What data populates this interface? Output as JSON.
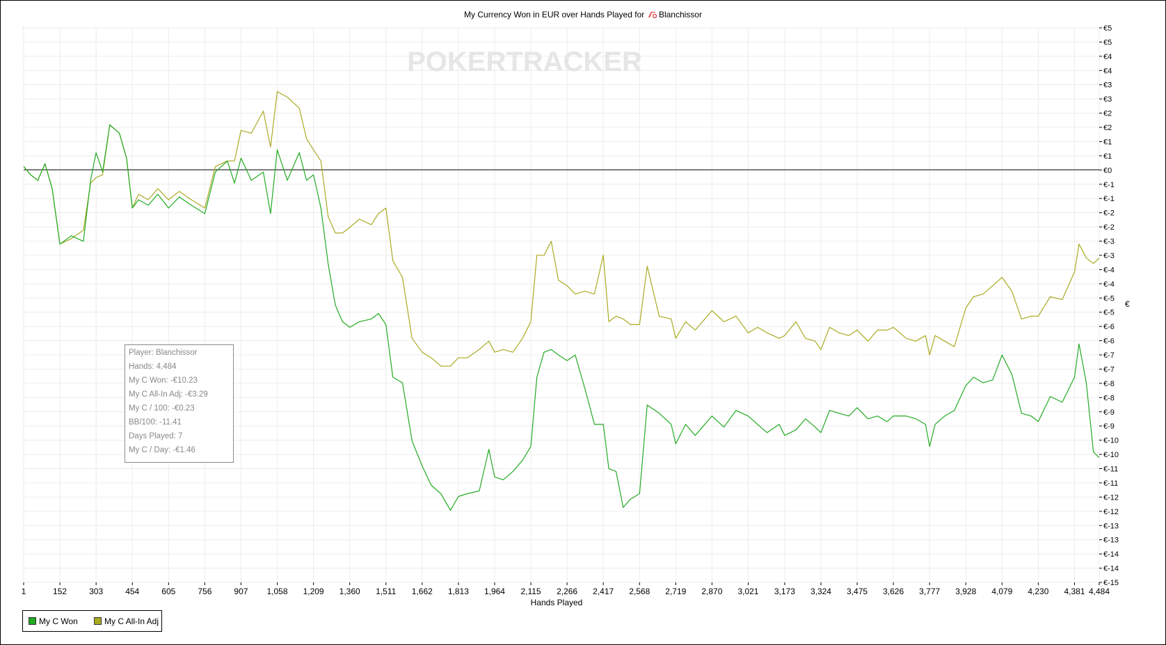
{
  "chart_data": {
    "type": "line",
    "title": "My Currency Won in EUR over Hands Played for  Blanchissor",
    "title_text": "My Currency Won in EUR over Hands Played for",
    "player_name": "Blanchissor",
    "xlabel": "Hands Played",
    "ylabel": "€",
    "xlim": [
      1,
      4484
    ],
    "ylim": [
      -15,
      5
    ],
    "grid": true,
    "legend_position": "bottom-left",
    "x_ticks": [
      "1",
      "152",
      "303",
      "454",
      "605",
      "756",
      "907",
      "1,058",
      "1,209",
      "1,360",
      "1,511",
      "1,662",
      "1,813",
      "1,964",
      "2,115",
      "2,266",
      "2,417",
      "2,568",
      "2,719",
      "2,870",
      "3,021",
      "3,173",
      "3,324",
      "3,475",
      "3,626",
      "3,777",
      "3,928",
      "4,079",
      "4,230",
      "4,381",
      "4,484"
    ],
    "y_ticks": [
      "€5",
      "€5",
      "€4",
      "€4",
      "€3",
      "€3",
      "€2",
      "€2",
      "€1",
      "€1",
      "€0",
      "€-1",
      "€-1",
      "€-2",
      "€-2",
      "€-3",
      "€-3",
      "€-4",
      "€-4",
      "€-5",
      "€-5",
      "€-6",
      "€-6",
      "€-7",
      "€-7",
      "€-8",
      "€-8",
      "€-9",
      "€-9",
      "€-10",
      "€-10",
      "€-11",
      "€-11",
      "€-12",
      "€-12",
      "€-13",
      "€-13",
      "€-14",
      "€-14",
      "€-15"
    ],
    "series": [
      {
        "name": "My C Won",
        "color": "#22aa22",
        "x": [
          1,
          30,
          60,
          90,
          120,
          152,
          200,
          250,
          280,
          303,
          330,
          360,
          400,
          430,
          454,
          480,
          520,
          560,
          605,
          650,
          700,
          756,
          800,
          850,
          880,
          907,
          950,
          1000,
          1030,
          1058,
          1100,
          1150,
          1180,
          1209,
          1240,
          1270,
          1300,
          1330,
          1360,
          1400,
          1450,
          1480,
          1511,
          1540,
          1580,
          1620,
          1662,
          1700,
          1740,
          1780,
          1813,
          1850,
          1900,
          1940,
          1964,
          2000,
          2040,
          2080,
          2115,
          2140,
          2170,
          2200,
          2230,
          2266,
          2300,
          2340,
          2380,
          2417,
          2440,
          2470,
          2500,
          2530,
          2568,
          2600,
          2650,
          2700,
          2719,
          2760,
          2800,
          2870,
          2920,
          2970,
          3021,
          3060,
          3100,
          3150,
          3173,
          3220,
          3260,
          3300,
          3324,
          3360,
          3400,
          3440,
          3475,
          3520,
          3560,
          3600,
          3626,
          3680,
          3720,
          3760,
          3777,
          3800,
          3840,
          3880,
          3928,
          3960,
          4000,
          4040,
          4079,
          4120,
          4160,
          4200,
          4230,
          4280,
          4330,
          4381,
          4400,
          4430,
          4460,
          4484
        ],
        "values": [
          0,
          -0.3,
          -0.5,
          0.1,
          -0.8,
          -2.8,
          -2.5,
          -2.7,
          -0.5,
          0.5,
          -0.2,
          1.5,
          1.2,
          0.3,
          -1.5,
          -1.2,
          -1.4,
          -1.0,
          -1.5,
          -1.1,
          -1.4,
          -1.7,
          -0.2,
          0.2,
          -0.6,
          0.3,
          -0.5,
          -0.2,
          -1.7,
          0.6,
          -0.5,
          0.5,
          -0.5,
          -0.3,
          -1.5,
          -3.5,
          -5.0,
          -5.6,
          -5.8,
          -5.6,
          -5.5,
          -5.3,
          -5.7,
          -7.6,
          -7.8,
          -9.9,
          -10.8,
          -11.5,
          -11.8,
          -12.4,
          -11.9,
          -11.8,
          -11.7,
          -10.2,
          -11.2,
          -11.3,
          -11.0,
          -10.6,
          -10.1,
          -7.6,
          -6.7,
          -6.6,
          -6.8,
          -7.0,
          -6.8,
          -8.0,
          -9.3,
          -9.3,
          -10.9,
          -11.0,
          -12.3,
          -12.0,
          -11.8,
          -8.6,
          -8.9,
          -9.3,
          -10.0,
          -9.3,
          -9.7,
          -9.0,
          -9.4,
          -8.8,
          -9.0,
          -9.3,
          -9.6,
          -9.3,
          -9.7,
          -9.5,
          -9.1,
          -9.4,
          -9.6,
          -8.8,
          -8.9,
          -9.0,
          -8.7,
          -9.1,
          -9.0,
          -9.2,
          -9.0,
          -9.0,
          -9.1,
          -9.3,
          -10.1,
          -9.3,
          -9.0,
          -8.8,
          -7.9,
          -7.6,
          -7.8,
          -7.7,
          -6.8,
          -7.5,
          -8.9,
          -9.0,
          -9.2,
          -8.3,
          -8.5,
          -7.6,
          -6.4,
          -7.8,
          -10.3,
          -10.5
        ]
      },
      {
        "name": "My C All-In Adj",
        "color": "#aaaa22",
        "x": [
          1,
          30,
          60,
          90,
          120,
          152,
          200,
          250,
          280,
          303,
          330,
          360,
          400,
          430,
          454,
          480,
          520,
          560,
          605,
          650,
          700,
          756,
          800,
          850,
          880,
          907,
          950,
          1000,
          1030,
          1058,
          1100,
          1150,
          1180,
          1209,
          1240,
          1270,
          1300,
          1330,
          1360,
          1400,
          1450,
          1480,
          1511,
          1540,
          1580,
          1620,
          1662,
          1700,
          1740,
          1780,
          1813,
          1850,
          1900,
          1940,
          1964,
          2000,
          2040,
          2080,
          2115,
          2140,
          2170,
          2200,
          2230,
          2266,
          2300,
          2340,
          2380,
          2417,
          2440,
          2470,
          2500,
          2530,
          2568,
          2600,
          2650,
          2700,
          2719,
          2760,
          2800,
          2870,
          2920,
          2970,
          3021,
          3060,
          3100,
          3150,
          3173,
          3220,
          3260,
          3300,
          3324,
          3360,
          3400,
          3440,
          3475,
          3520,
          3560,
          3600,
          3626,
          3680,
          3720,
          3760,
          3777,
          3800,
          3840,
          3880,
          3928,
          3960,
          4000,
          4040,
          4079,
          4120,
          4160,
          4200,
          4230,
          4280,
          4330,
          4381,
          4400,
          4430,
          4460,
          4484
        ],
        "values": [
          0,
          -0.3,
          -0.5,
          0.1,
          -0.8,
          -2.8,
          -2.6,
          -2.3,
          -0.6,
          -0.4,
          -0.3,
          1.5,
          1.2,
          0.3,
          -1.5,
          -1.0,
          -1.2,
          -0.8,
          -1.2,
          -0.9,
          -1.2,
          -1.5,
          0.0,
          0.2,
          0.2,
          1.3,
          1.2,
          2.0,
          0.7,
          2.7,
          2.5,
          2.1,
          1.0,
          0.6,
          0.2,
          -1.8,
          -2.4,
          -2.4,
          -2.2,
          -1.9,
          -2.1,
          -1.7,
          -1.5,
          -3.4,
          -4.0,
          -6.2,
          -6.7,
          -6.9,
          -7.2,
          -7.2,
          -6.9,
          -6.9,
          -6.6,
          -6.3,
          -6.7,
          -6.6,
          -6.7,
          -6.2,
          -5.6,
          -3.2,
          -3.2,
          -2.7,
          -4.1,
          -4.3,
          -4.6,
          -4.5,
          -4.6,
          -3.2,
          -5.6,
          -5.4,
          -5.5,
          -5.7,
          -5.7,
          -3.6,
          -5.4,
          -5.5,
          -6.2,
          -5.6,
          -5.9,
          -5.2,
          -5.6,
          -5.4,
          -6.0,
          -5.8,
          -6.0,
          -6.2,
          -6.1,
          -5.6,
          -6.2,
          -6.3,
          -6.6,
          -5.8,
          -6.0,
          -6.1,
          -5.9,
          -6.3,
          -5.9,
          -5.9,
          -5.8,
          -6.2,
          -6.3,
          -6.1,
          -6.8,
          -6.1,
          -6.3,
          -6.5,
          -5.1,
          -4.7,
          -4.6,
          -4.3,
          -4.0,
          -4.5,
          -5.5,
          -5.4,
          -5.4,
          -4.7,
          -4.8,
          -3.8,
          -2.8,
          -3.3,
          -3.5,
          -3.3
        ]
      }
    ]
  },
  "watermark": "POKERTRACKER",
  "stats_box": {
    "player": "Player: Blanchissor",
    "hands": "Hands: 4,484",
    "won": "My C Won: -€10.23",
    "allin": "My C All-In Adj: -€3.29",
    "per100": "My C / 100: -€0.23",
    "bb100": "BB/100: -11.41",
    "days": "Days Played: 7",
    "perday": "My C / Day: -€1.46"
  },
  "legend": {
    "won": "My C Won",
    "allin": "My C All-In Adj",
    "won_color": "#22aa22",
    "allin_color": "#aaaa22"
  }
}
